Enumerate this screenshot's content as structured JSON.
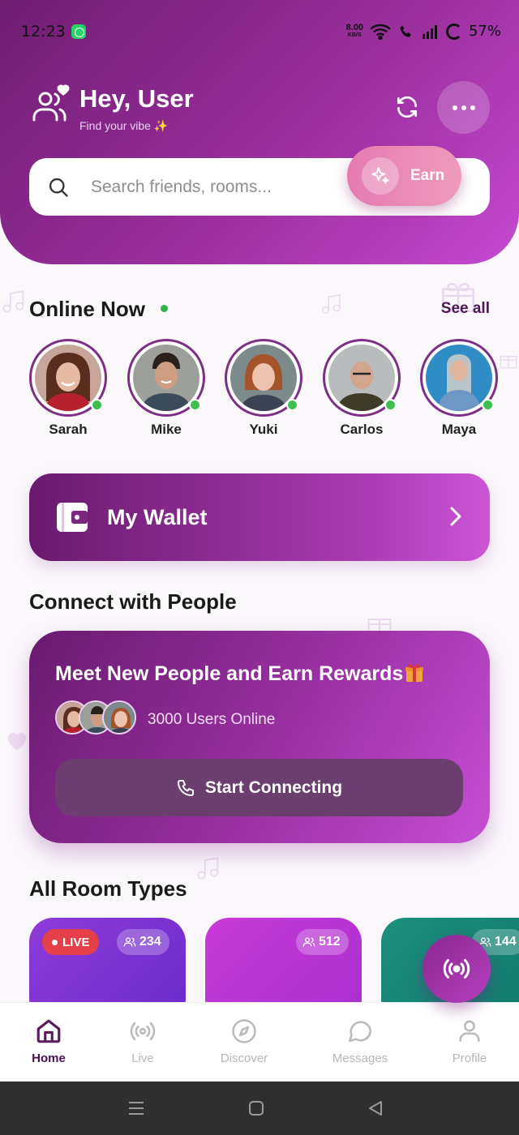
{
  "status_bar": {
    "time": "12:23",
    "net_speed": "8.00",
    "net_unit": "KB/S",
    "battery": "57%"
  },
  "header": {
    "greeting": "Hey, User",
    "tagline": "Find your vibe ✨",
    "search_placeholder": "Search friends, rooms...",
    "earn_label": "Earn"
  },
  "online_now": {
    "title": "Online Now",
    "see_all": "See all",
    "friends": [
      {
        "name": "Sarah"
      },
      {
        "name": "Mike"
      },
      {
        "name": "Yuki"
      },
      {
        "name": "Carlos"
      },
      {
        "name": "Maya"
      }
    ]
  },
  "wallet": {
    "label": "My Wallet"
  },
  "connect": {
    "section_title": "Connect with People",
    "card_title": "Meet New People and Earn Rewards",
    "users_online": "3000 Users Online",
    "button_label": "Start Connecting"
  },
  "rooms": {
    "section_title": "All Room Types",
    "cards": [
      {
        "live": "LIVE",
        "count": "234",
        "color": "#7b31d8"
      },
      {
        "count": "512",
        "color": "#c23ad8"
      },
      {
        "count": "144",
        "color": "#148a78"
      }
    ]
  },
  "nav": {
    "items": [
      {
        "label": "Home",
        "icon": "home-icon",
        "active": true
      },
      {
        "label": "Live",
        "icon": "broadcast-icon"
      },
      {
        "label": "Discover",
        "icon": "compass-icon"
      },
      {
        "label": "Messages",
        "icon": "chat-icon"
      },
      {
        "label": "Profile",
        "icon": "user-icon"
      }
    ]
  },
  "colors": {
    "brand_dark": "#6f1d72",
    "brand_light": "#c44ad0",
    "online_green": "#3fbd4e",
    "live_red": "#e53f4a"
  }
}
